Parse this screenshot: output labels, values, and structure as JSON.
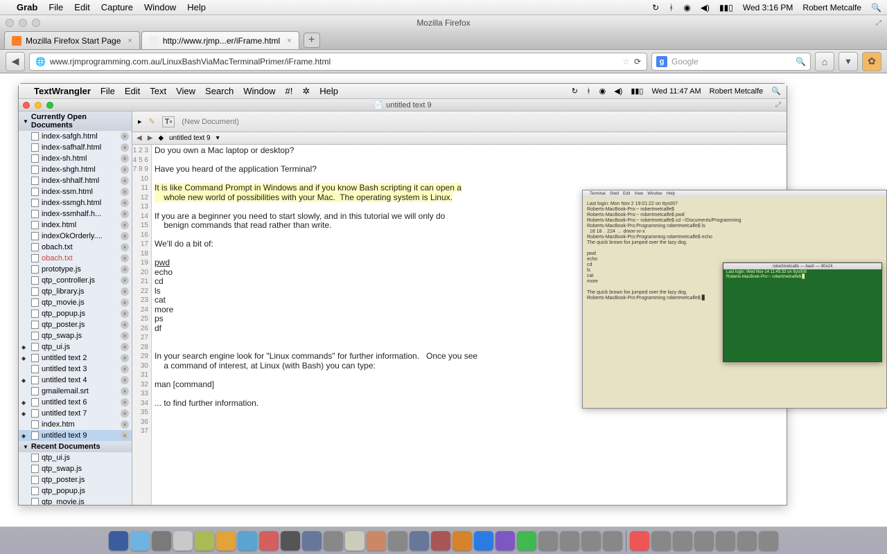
{
  "outer_menubar": {
    "app": "Grab",
    "items": [
      "File",
      "Edit",
      "Capture",
      "Window",
      "Help"
    ],
    "clock": "Wed 3:16 PM",
    "user": "Robert Metcalfe"
  },
  "firefox": {
    "title": "Mozilla Firefox",
    "tabs": [
      {
        "label": "Mozilla Firefox Start Page",
        "active": false
      },
      {
        "label": "http://www.rjmp...er/iFrame.html",
        "active": true
      }
    ],
    "url": "www.rjmprogramming.com.au/LinuxBashViaMacTerminalPrimer/iFrame.html",
    "search_placeholder": "Google"
  },
  "textwrangler": {
    "menubar": {
      "app": "TextWrangler",
      "items": [
        "File",
        "Edit",
        "Text",
        "View",
        "Search",
        "Window",
        "#!",
        "✲",
        "Help"
      ],
      "clock": "Wed 11:47 AM",
      "user": "Robert Metcalfe"
    },
    "title": "untitled text 9",
    "new_doc": "(New Document)",
    "doc_selector": "untitled text 9",
    "sidebar": {
      "open_header": "Currently Open Documents",
      "recent_header": "Recent Documents",
      "open": [
        {
          "name": "index-safgh.html"
        },
        {
          "name": "index-safhalf.html"
        },
        {
          "name": "index-sh.html"
        },
        {
          "name": "index-shgh.html"
        },
        {
          "name": "index-shhalf.html"
        },
        {
          "name": "index-ssm.html"
        },
        {
          "name": "index-ssmgh.html"
        },
        {
          "name": "index-ssmhalf.h..."
        },
        {
          "name": "index.html"
        },
        {
          "name": "indexOkOrderly...."
        },
        {
          "name": "obach.txt"
        },
        {
          "name": "obach.txt",
          "mod": true
        },
        {
          "name": "prototype.js"
        },
        {
          "name": "qtp_controller.js"
        },
        {
          "name": "qtp_library.js"
        },
        {
          "name": "qtp_movie.js"
        },
        {
          "name": "qtp_popup.js"
        },
        {
          "name": "qtp_poster.js"
        },
        {
          "name": "qtp_swap.js"
        },
        {
          "name": "qtp_ui.js",
          "diamond": true
        },
        {
          "name": "untitled text 2",
          "diamond": true
        },
        {
          "name": "untitled text 3"
        },
        {
          "name": "untitled text 4",
          "diamond": true
        },
        {
          "name": "gmailemail.srt"
        },
        {
          "name": "untitled text 6",
          "diamond": true
        },
        {
          "name": "untitled text 7",
          "diamond": true
        },
        {
          "name": "index.htm"
        },
        {
          "name": "untitled text 9",
          "diamond": true,
          "sel": true
        }
      ],
      "recent": [
        {
          "name": "qtp_ui.js"
        },
        {
          "name": "qtp_swap.js"
        },
        {
          "name": "qtp_poster.js"
        },
        {
          "name": "qtp_popup.js"
        },
        {
          "name": "qtp_movie.js"
        }
      ]
    },
    "code_lines": [
      "Do you own a Mac laptop or desktop?",
      "",
      "Have you heard of the application Terminal?",
      "",
      "It is like Command Prompt in Windows and if you know Bash scripting it can open a",
      "    whole new world of possibilities with your Mac.  The operating system is Linux.",
      "",
      "If you are a beginner you need to start slowly, and in this tutorial we will only do",
      "    benign commands that read rather than write.",
      "",
      "We'll do a bit of:",
      "",
      "pwd",
      "echo",
      "cd",
      "ls",
      "cat",
      "more",
      "ps",
      "df",
      "",
      "",
      "In your search engine look for \"Linux commands\" for further information.   Once you see",
      "    a command of interest, at Linux (with Bash) you can type:",
      "",
      "man [command]",
      "",
      "... to find further information.",
      "",
      "",
      "",
      "",
      "",
      "",
      "",
      "",
      ""
    ],
    "highlight_lines": [
      5,
      6,
      7
    ]
  },
  "terminal_menu": [
    "Terminal",
    "Shell",
    "Edit",
    "View",
    "Window",
    "Help"
  ],
  "terminal_title": "robertmetcalfe — bash — 80x24",
  "dock_colors": [
    "#3b5c9e",
    "#6fb3e0",
    "#7a7a7a",
    "#c9c9c9",
    "#aabb55",
    "#e1a33a",
    "#5ba3d0",
    "#d35f5f",
    "#555",
    "#679",
    "#888",
    "#ccb",
    "#c86",
    "#888",
    "#679",
    "#a55",
    "#d7832b",
    "#2b7be4",
    "#7e57c2",
    "#3fb950",
    "#888",
    "#888",
    "#888",
    "#888",
    "#e55",
    "#888",
    "#888",
    "#888",
    "#888",
    "#888",
    "#888"
  ]
}
